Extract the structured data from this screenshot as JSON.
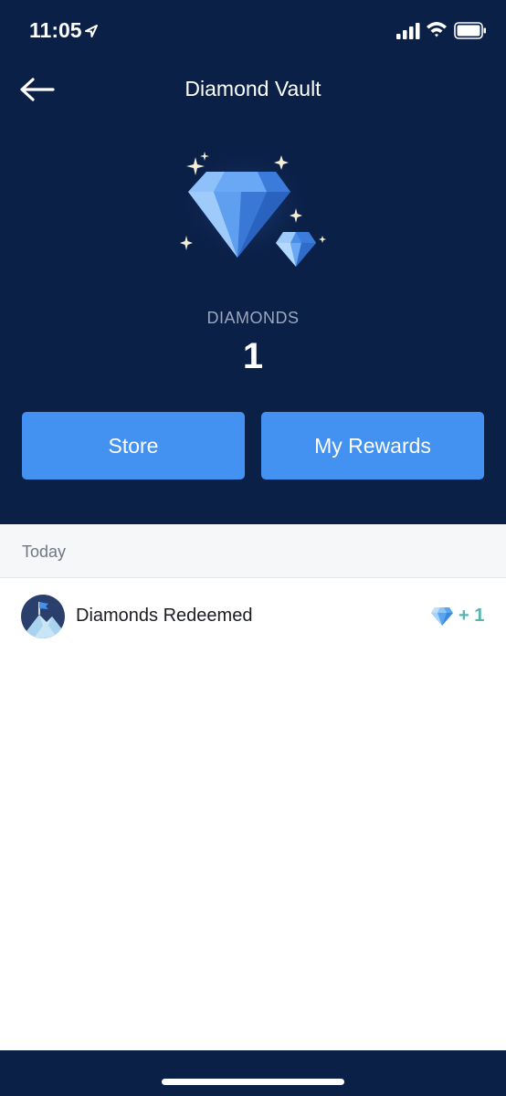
{
  "status": {
    "time": "11:05"
  },
  "nav": {
    "title": "Diamond Vault"
  },
  "balance": {
    "label": "DIAMONDS",
    "value": "1"
  },
  "actions": {
    "store_label": "Store",
    "rewards_label": "My Rewards"
  },
  "history": {
    "section_title": "Today",
    "items": [
      {
        "title": "Diamonds Redeemed",
        "amount": "+ 1",
        "icon": "mountain-flag-icon"
      }
    ]
  },
  "colors": {
    "header_bg": "#0b2047",
    "button_bg": "#4391f0",
    "amount_text": "#54b6ae",
    "section_bg": "#f6f7f9"
  }
}
